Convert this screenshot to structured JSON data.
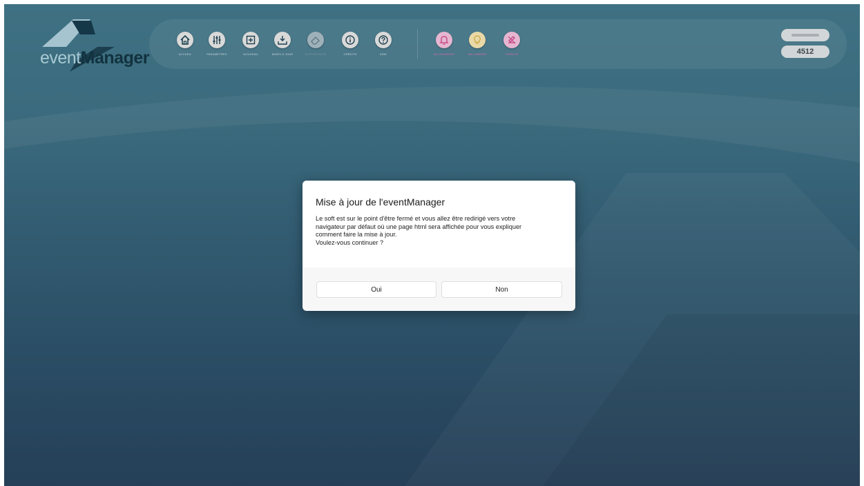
{
  "logo": {
    "text_a": "event",
    "text_b": "Manager"
  },
  "toolbar": {
    "buttons": [
      {
        "label": "ACCUEIL",
        "icon": "home-icon"
      },
      {
        "label": "PARAMÈTRES",
        "icon": "sliders-icon"
      },
      {
        "label": "NOUVEAU",
        "icon": "plus-square-icon"
      },
      {
        "label": "MISES À JOUR",
        "icon": "download-icon"
      },
      {
        "label": "SUPPRESSION",
        "icon": "eraser-icon"
      },
      {
        "label": "CRÉDITS",
        "icon": "info-icon"
      },
      {
        "label": "AIDE",
        "icon": "help-icon"
      },
      {
        "label": "MA SONNERIE",
        "icon": "bell-icon"
      },
      {
        "label": "MA LUMIÈRE",
        "icon": "bulb-icon"
      },
      {
        "label": "CRÉDITS",
        "icon": "sign-icon"
      }
    ],
    "counter": "4512"
  },
  "dialog": {
    "title": "Mise à jour de l'eventManager",
    "message": "Le soft est sur le point d'être fermé et vous allez être redirigé vers votre\nnavigateur par défaut où une page html sera affichée pour vous expliquer\ncomment faire la mise à jour.\nVoulez-vous continuer ?",
    "yes_label": "Oui",
    "no_label": "Non"
  },
  "colors": {
    "background_top": "#3e7183",
    "background_bottom": "#253f58",
    "accent_pink": "#d96aa8",
    "logo_dark": "#12323f"
  }
}
